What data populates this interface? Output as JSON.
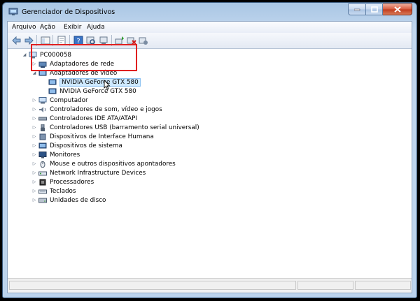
{
  "window": {
    "title": "Gerenciador de Dispositivos"
  },
  "menu": [
    "Arquivo",
    "Ação",
    "Exibir",
    "Ajuda"
  ],
  "toolbar_icons": [
    "back-icon",
    "forward-icon",
    "show-hide-icon",
    "properties-icon",
    "help-icon",
    "scan-hardware-icon",
    "update-driver-icon",
    "uninstall-icon",
    "disable-icon",
    "enable-icon"
  ],
  "tree": {
    "root": "PC000058",
    "items": [
      {
        "label": "Adaptadores de rede",
        "icon": "network-adapter-icon",
        "expanded": false
      },
      {
        "label": "Adaptadores de vídeo",
        "icon": "display-adapter-icon",
        "expanded": true,
        "children": [
          {
            "label": "NVIDIA GeForce GTX 580",
            "icon": "gpu-icon",
            "selected": true
          },
          {
            "label": "NVIDIA GeForce GTX 580",
            "icon": "gpu-icon",
            "selected": false
          }
        ]
      },
      {
        "label": "Computador",
        "icon": "computer-icon"
      },
      {
        "label": "Controladores de som, vídeo e jogos",
        "icon": "sound-icon"
      },
      {
        "label": "Controladores IDE ATA/ATAPI",
        "icon": "ide-icon"
      },
      {
        "label": "Controladores USB (barramento serial universal)",
        "icon": "usb-icon"
      },
      {
        "label": "Dispositivos de Interface Humana",
        "icon": "hid-icon"
      },
      {
        "label": "Dispositivos de sistema",
        "icon": "system-device-icon"
      },
      {
        "label": "Monitores",
        "icon": "monitor-icon"
      },
      {
        "label": "Mouse e outros dispositivos apontadores",
        "icon": "mouse-icon"
      },
      {
        "label": "Network Infrastructure Devices",
        "icon": "network-infrastructure-icon"
      },
      {
        "label": "Processadores",
        "icon": "processor-icon"
      },
      {
        "label": "Teclados",
        "icon": "keyboard-icon"
      },
      {
        "label": "Unidades de disco",
        "icon": "disk-drive-icon"
      }
    ]
  },
  "colors": {
    "highlight_box": "#e02020",
    "selection": "#cde8ff"
  }
}
